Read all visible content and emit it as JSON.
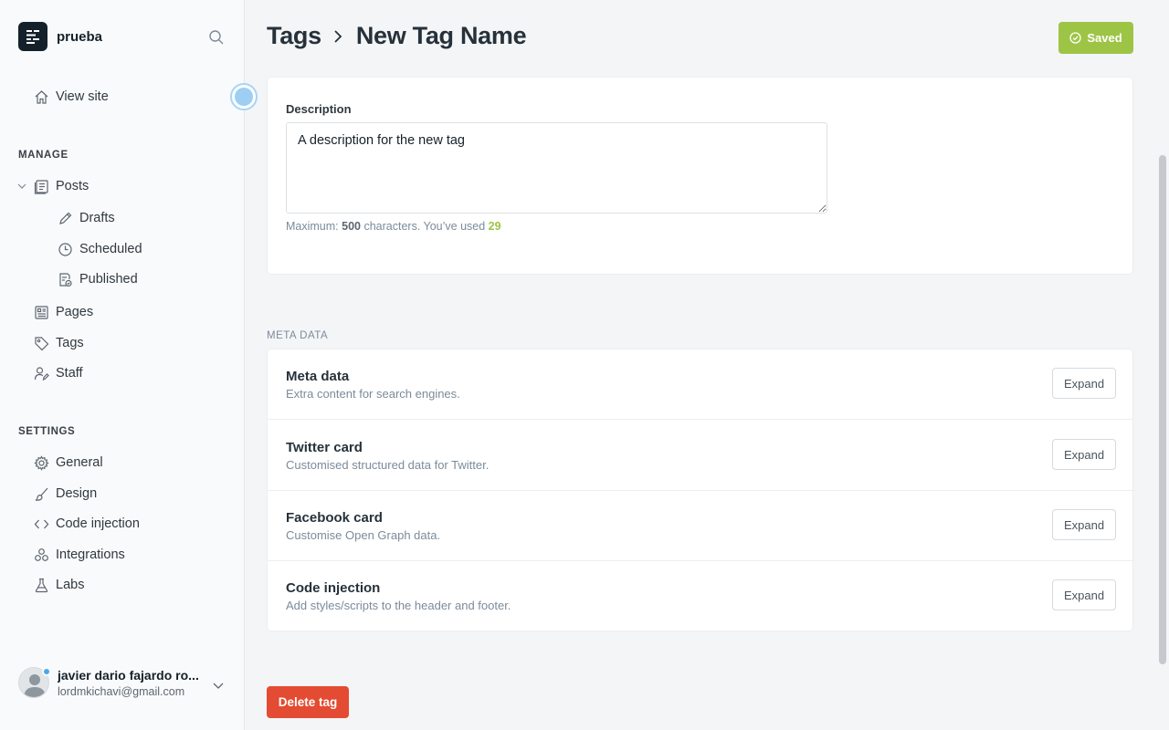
{
  "sidebar": {
    "site_name": "prueba",
    "view_site": "View site",
    "manage_label": "MANAGE",
    "posts": "Posts",
    "drafts": "Drafts",
    "scheduled": "Scheduled",
    "published": "Published",
    "pages": "Pages",
    "tags": "Tags",
    "staff": "Staff",
    "settings_label": "SETTINGS",
    "general": "General",
    "design": "Design",
    "code_injection": "Code injection",
    "integrations": "Integrations",
    "labs": "Labs"
  },
  "user": {
    "name": "javier dario fajardo ro...",
    "email": "lordmkichavi@gmail.com"
  },
  "header": {
    "crumb_parent": "Tags",
    "crumb_current": "New Tag Name",
    "saved_label": "Saved"
  },
  "description": {
    "label": "Description",
    "value": "A description for the new tag",
    "hint_prefix": "Maximum: ",
    "hint_max": "500",
    "hint_mid": " characters. You’ve used ",
    "hint_used": "29"
  },
  "meta": {
    "section_label": "META DATA",
    "rows": [
      {
        "title": "Meta data",
        "subtitle": "Extra content for search engines.",
        "button": "Expand"
      },
      {
        "title": "Twitter card",
        "subtitle": "Customised structured data for Twitter.",
        "button": "Expand"
      },
      {
        "title": "Facebook card",
        "subtitle": "Customise Open Graph data.",
        "button": "Expand"
      },
      {
        "title": "Code injection",
        "subtitle": "Add styles/scripts to the header and footer.",
        "button": "Expand"
      }
    ]
  },
  "actions": {
    "delete_label": "Delete tag"
  },
  "colors": {
    "saved_green": "#9ec446",
    "delete_red": "#e34b32",
    "status_blue": "#4ba8ea"
  }
}
